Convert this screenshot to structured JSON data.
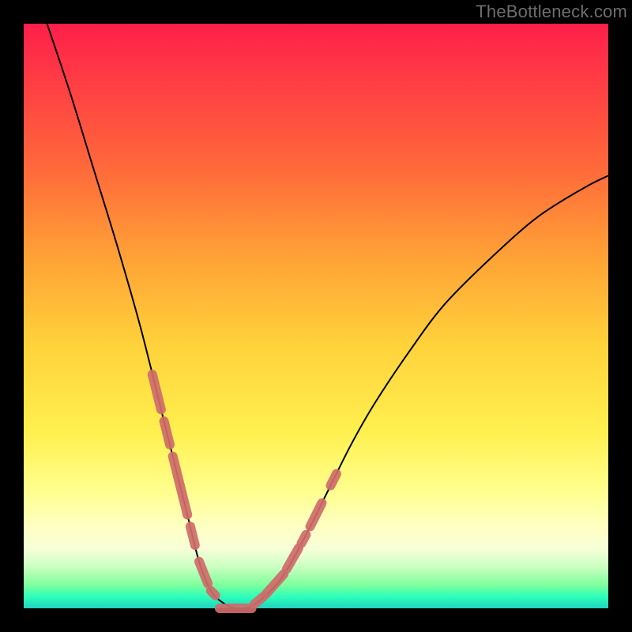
{
  "watermark": "TheBottleneck.com",
  "colors": {
    "frame": "#000000",
    "curve": "#000000",
    "marker": "#cf6b6a",
    "watermark_text": "#6e6e6e"
  },
  "chart_data": {
    "type": "line",
    "title": "",
    "xlabel": "",
    "ylabel": "",
    "xlim": [
      0,
      100
    ],
    "ylim": [
      0,
      100
    ],
    "grid": false,
    "legend": false,
    "note": "V-shaped bottleneck curve over vertical rainbow gradient. Values are visual estimates of curve height (100 = top of plot, 0 = bottom/green band). x is horizontal position in percent.",
    "series": [
      {
        "name": "curve",
        "x": [
          4,
          8,
          12,
          16,
          20,
          24,
          26,
          28,
          30,
          32,
          34,
          36,
          38,
          40,
          44,
          48,
          52,
          56,
          60,
          66,
          72,
          80,
          88,
          96,
          100
        ],
        "values": [
          100,
          88,
          75,
          62,
          48,
          32,
          24,
          16,
          8,
          3,
          1,
          0,
          0,
          1,
          5,
          12,
          20,
          28,
          35,
          44,
          52,
          60,
          67,
          72,
          74
        ]
      }
    ],
    "markers": {
      "name": "highlight-dots",
      "note": "Salmon bead-like markers clustered along the lower-left and lower-right of the V, plus a flat run at the vertex.",
      "segments": [
        {
          "side": "left",
          "x": [
            22.0,
            23.5
          ]
        },
        {
          "side": "left",
          "x": [
            24.0,
            25.0
          ]
        },
        {
          "side": "left",
          "x": [
            25.5,
            28.0
          ]
        },
        {
          "side": "left",
          "x": [
            28.5,
            29.3
          ]
        },
        {
          "side": "left",
          "x": [
            30.0,
            31.5
          ]
        },
        {
          "side": "left",
          "x": [
            32.0,
            32.8
          ]
        },
        {
          "side": "bottom",
          "x": [
            33.5,
            39.0
          ]
        },
        {
          "side": "right",
          "x": [
            39.5,
            41.0
          ]
        },
        {
          "side": "right",
          "x": [
            41.5,
            44.5
          ]
        },
        {
          "side": "right",
          "x": [
            45.0,
            47.0
          ]
        },
        {
          "side": "right",
          "x": [
            47.5,
            48.3
          ]
        },
        {
          "side": "right",
          "x": [
            49.0,
            51.0
          ]
        },
        {
          "side": "right",
          "x": [
            52.5,
            53.5
          ]
        }
      ]
    },
    "gradient_stops": [
      {
        "pos": 0,
        "color": "#ff1f4a"
      },
      {
        "pos": 10,
        "color": "#ff3d44"
      },
      {
        "pos": 25,
        "color": "#ff6a3a"
      },
      {
        "pos": 40,
        "color": "#ffa236"
      },
      {
        "pos": 55,
        "color": "#ffd23a"
      },
      {
        "pos": 70,
        "color": "#fff050"
      },
      {
        "pos": 80,
        "color": "#ffff8e"
      },
      {
        "pos": 86,
        "color": "#ffffc2"
      },
      {
        "pos": 90,
        "color": "#f5ffd8"
      },
      {
        "pos": 93,
        "color": "#c8ffc0"
      },
      {
        "pos": 96,
        "color": "#7fff9c"
      },
      {
        "pos": 98,
        "color": "#2dffb9"
      },
      {
        "pos": 100,
        "color": "#1fd3c0"
      }
    ]
  }
}
